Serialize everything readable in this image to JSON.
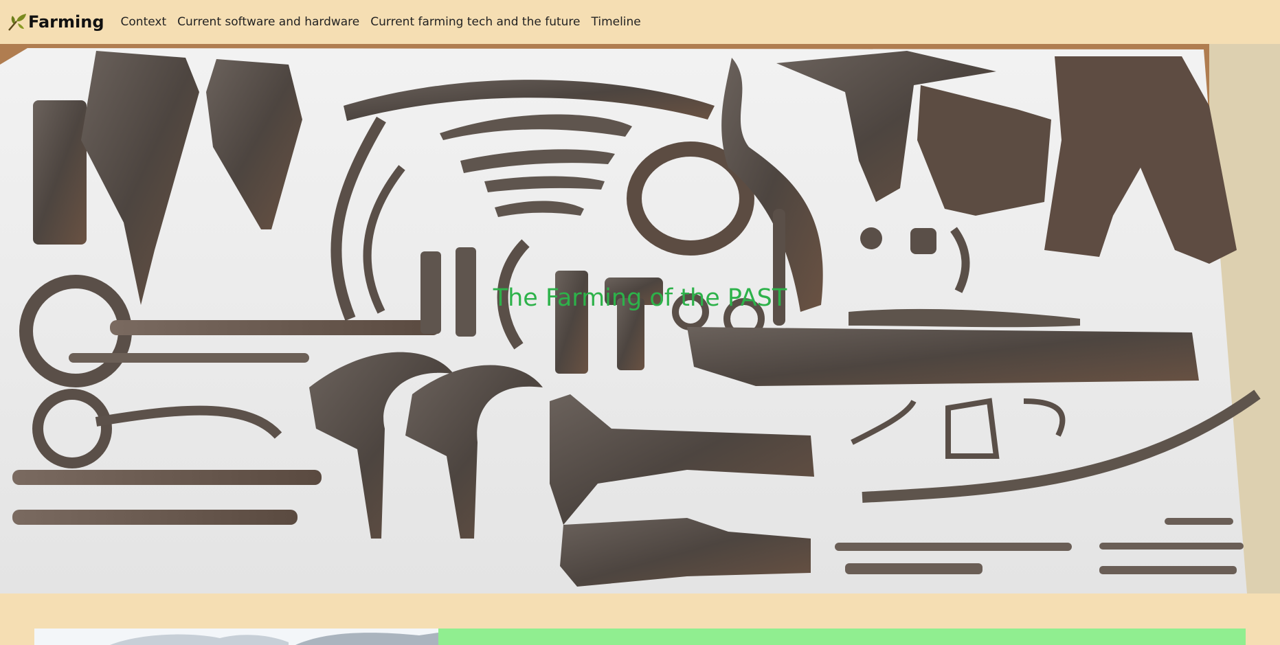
{
  "navbar": {
    "brand": "Farming",
    "brand_icon": "sprout-icon",
    "links": [
      {
        "label": "Context"
      },
      {
        "label": "Current software and hardware"
      },
      {
        "label": "Current farming tech and the future"
      },
      {
        "label": "Timeline"
      }
    ]
  },
  "hero": {
    "title": "The Farming of the PAST",
    "image": "rusty-farming-tools-photo"
  },
  "colors": {
    "page_background": "#f5deb3",
    "hero_title": "#2db24a",
    "green_panel": "#90ee90"
  }
}
